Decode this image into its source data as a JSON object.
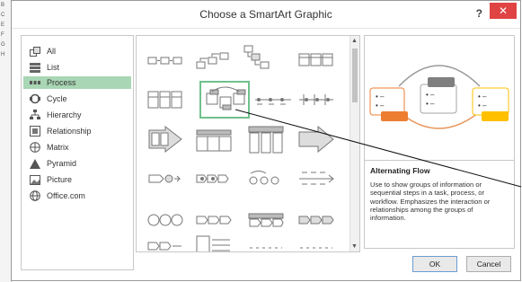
{
  "background": {
    "left_edge_letters": [
      "B",
      "C",
      "E",
      "F",
      "G",
      "H"
    ]
  },
  "dialog": {
    "title": "Choose a SmartArt Graphic",
    "help_label": "?",
    "close_label": "✕"
  },
  "categories": [
    {
      "label": "All",
      "icon": "all-icon"
    },
    {
      "label": "List",
      "icon": "list-icon"
    },
    {
      "label": "Process",
      "icon": "process-icon",
      "selected": true
    },
    {
      "label": "Cycle",
      "icon": "cycle-icon"
    },
    {
      "label": "Hierarchy",
      "icon": "hierarchy-icon"
    },
    {
      "label": "Relationship",
      "icon": "relationship-icon"
    },
    {
      "label": "Matrix",
      "icon": "matrix-icon"
    },
    {
      "label": "Pyramid",
      "icon": "pyramid-icon"
    },
    {
      "label": "Picture",
      "icon": "picture-icon"
    },
    {
      "label": "Office.com",
      "icon": "globe-icon"
    }
  ],
  "gallery": {
    "selected_layout": "Alternating Flow"
  },
  "preview": {
    "title": "Alternating Flow",
    "description": "Use to show groups of information or sequential steps in a task, process, or workflow. Emphasizes the interaction or relationships among the groups of information."
  },
  "buttons": {
    "ok": "OK",
    "cancel": "Cancel"
  },
  "colors": {
    "accent_blue": "#5b9bd5",
    "orange": "#ed7d31",
    "gray": "#a5a5a5",
    "gold": "#ffc000",
    "selected_green": "#a9d6b4"
  }
}
